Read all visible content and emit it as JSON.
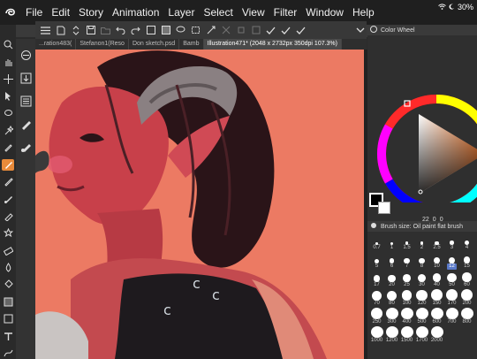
{
  "status": {
    "battery": "30%"
  },
  "menu": [
    "File",
    "Edit",
    "Story",
    "Animation",
    "Layer",
    "Select",
    "View",
    "Filter",
    "Window",
    "Help"
  ],
  "tabs": [
    {
      "label": "...ration483(",
      "active": false
    },
    {
      "label": "Stefanon1(Reso",
      "active": false
    },
    {
      "label": "Don sketch.psd",
      "active": false
    },
    {
      "label": "Bamb",
      "active": false
    },
    {
      "label": "Illustration471* (2048 x 2732px 350dpi 107.3%)",
      "active": true
    }
  ],
  "colorPanel": {
    "title": "Color Wheel",
    "values": [
      "22",
      "0",
      "0"
    ]
  },
  "brushPanel": {
    "title": "Brush size: Oil paint flat brush",
    "selected": "12",
    "sizes": [
      "0.7",
      "1",
      "1.5",
      "2",
      "2.5",
      "3",
      "4",
      "5",
      "6",
      "7",
      "8",
      "10",
      "12",
      "15",
      "17",
      "20",
      "25",
      "30",
      "40",
      "50",
      "60",
      "70",
      "80",
      "100",
      "120",
      "150",
      "170",
      "200",
      "250",
      "300",
      "400",
      "500",
      "600",
      "700",
      "800",
      "1000",
      "1200",
      "1500",
      "1700",
      "2000"
    ]
  },
  "colors": {
    "canvas": "#ec7a63",
    "accent": "#e88a3a",
    "select": "#5a79c8"
  }
}
